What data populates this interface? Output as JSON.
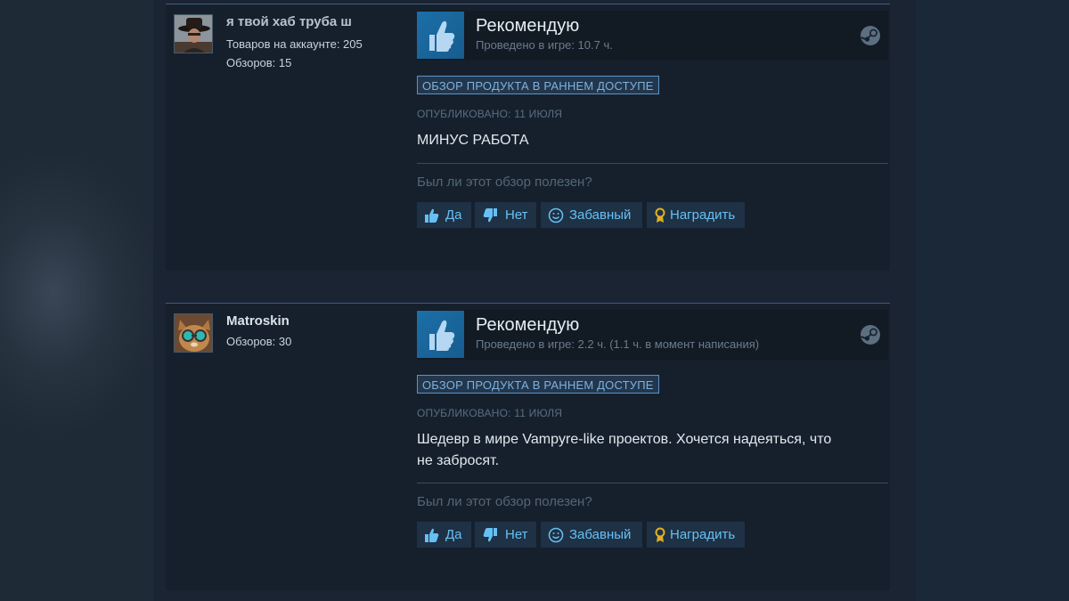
{
  "reviews": [
    {
      "author": {
        "name": "я твой хаб труба ш",
        "products": "Товаров на аккаунте: 205",
        "reviews": "Обзоров: 15"
      },
      "verdict": "Рекомендую",
      "hours": "Проведено в игре: 10.7 ч.",
      "early_access": "ОБЗОР ПРОДУКТА В РАННЕМ ДОСТУПЕ",
      "posted": "ОПУБЛИКОВАНО: 11 ИЮЛЯ",
      "text": "МИНУС РАБОТА",
      "helpful_q": "Был ли этот обзор полезен?",
      "buttons": {
        "yes": "Да",
        "no": "Нет",
        "funny": "Забавный",
        "award": "Наградить"
      }
    },
    {
      "author": {
        "name": "Matroskin",
        "reviews": "Обзоров: 30"
      },
      "verdict": "Рекомендую",
      "hours": "Проведено в игре: 2.2 ч. (1.1 ч. в момент написания)",
      "early_access": "ОБЗОР ПРОДУКТА В РАННЕМ ДОСТУПЕ",
      "posted": "ОПУБЛИКОВАНО: 11 ИЮЛЯ",
      "text_line1": "Шедевр в мире Vampyre-like проектов. Хочется надеяться, что",
      "text_line2": "не забросят.",
      "helpful_q": "Был ли этот обзор полезен?",
      "buttons": {
        "yes": "Да",
        "no": "Нет",
        "funny": "Забавный",
        "award": "Наградить"
      }
    }
  ],
  "colors": {
    "accent": "#66c0f4",
    "badge": "#7fb0dc",
    "thumb_bg": "#1b6fa8",
    "award": "#e0b020"
  }
}
